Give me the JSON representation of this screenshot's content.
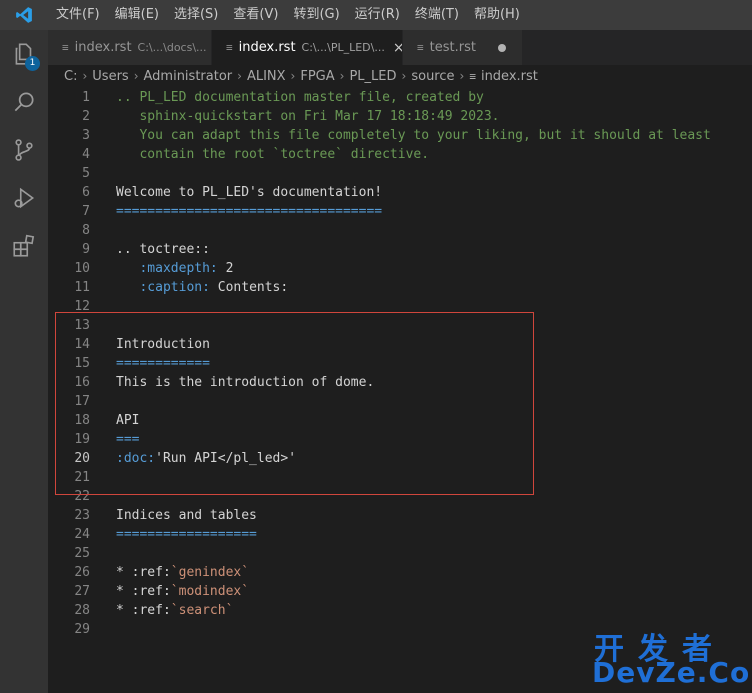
{
  "menu": [
    "文件(F)",
    "编辑(E)",
    "选择(S)",
    "查看(V)",
    "转到(G)",
    "运行(R)",
    "终端(T)",
    "帮助(H)"
  ],
  "activity": {
    "explorer_badge": "1",
    "icons": [
      "files-icon",
      "search-icon",
      "source-control-icon",
      "run-debug-icon",
      "extensions-icon"
    ]
  },
  "tabs": [
    {
      "label": "index.rst",
      "path": "C:\\...\\docs\\...",
      "active": false
    },
    {
      "label": "index.rst",
      "path": "C:\\...\\PL_LED\\...",
      "active": true,
      "close": "×"
    },
    {
      "label": "test.rst",
      "path": "",
      "active": false,
      "dirty": true
    }
  ],
  "breadcrumb": [
    "C:",
    "Users",
    "Administrator",
    "ALINX",
    "FPGA",
    "PL_LED",
    "source",
    "index.rst"
  ],
  "editor": {
    "current_line": 20,
    "lines": [
      {
        "n": "1",
        "tokens": [
          [
            "comment",
            ".. PL_LED documentation master file, created by"
          ]
        ]
      },
      {
        "n": "2",
        "tokens": [
          [
            "comment",
            "   sphinx-quickstart on Fri Mar 17 18:18:49 2023."
          ]
        ]
      },
      {
        "n": "3",
        "tokens": [
          [
            "comment",
            "   You can adapt this file completely to your liking, but it should at least"
          ]
        ]
      },
      {
        "n": "4",
        "tokens": [
          [
            "comment",
            "   contain the root `toctree` directive."
          ]
        ]
      },
      {
        "n": "5",
        "tokens": []
      },
      {
        "n": "6",
        "tokens": [
          [
            "heading",
            "Welcome to PL_LED's documentation!"
          ]
        ]
      },
      {
        "n": "7",
        "tokens": [
          [
            "rule",
            "=================================="
          ]
        ]
      },
      {
        "n": "8",
        "tokens": []
      },
      {
        "n": "9",
        "tokens": [
          [
            "white",
            ".. toctree::"
          ]
        ]
      },
      {
        "n": "10",
        "tokens": [
          [
            "white",
            "   "
          ],
          [
            "field",
            ":maxdepth:"
          ],
          [
            "white",
            " 2"
          ]
        ]
      },
      {
        "n": "11",
        "tokens": [
          [
            "white",
            "   "
          ],
          [
            "field",
            ":caption:"
          ],
          [
            "white",
            " Contents:"
          ]
        ]
      },
      {
        "n": "12",
        "tokens": []
      },
      {
        "n": "13",
        "tokens": []
      },
      {
        "n": "14",
        "tokens": [
          [
            "heading",
            "Introduction"
          ]
        ]
      },
      {
        "n": "15",
        "tokens": [
          [
            "rule",
            "============"
          ]
        ]
      },
      {
        "n": "16",
        "tokens": [
          [
            "white",
            "This is the introduction of dome."
          ]
        ]
      },
      {
        "n": "17",
        "tokens": []
      },
      {
        "n": "18",
        "tokens": [
          [
            "heading",
            "API"
          ]
        ]
      },
      {
        "n": "19",
        "tokens": [
          [
            "rule",
            "==="
          ]
        ]
      },
      {
        "n": "20",
        "tokens": [
          [
            "field",
            ":doc:"
          ],
          [
            "white",
            "'Run API</pl_led>'"
          ]
        ]
      },
      {
        "n": "21",
        "tokens": []
      },
      {
        "n": "22",
        "tokens": []
      },
      {
        "n": "23",
        "tokens": [
          [
            "heading",
            "Indices and tables"
          ]
        ]
      },
      {
        "n": "24",
        "tokens": [
          [
            "rule",
            "=================="
          ]
        ]
      },
      {
        "n": "25",
        "tokens": []
      },
      {
        "n": "26",
        "tokens": [
          [
            "white",
            "* :ref:"
          ],
          [
            "string",
            "`genindex`"
          ]
        ]
      },
      {
        "n": "27",
        "tokens": [
          [
            "white",
            "* :ref:"
          ],
          [
            "string",
            "`modindex`"
          ]
        ]
      },
      {
        "n": "28",
        "tokens": [
          [
            "white",
            "* :ref:"
          ],
          [
            "string",
            "`search`"
          ]
        ]
      },
      {
        "n": "29",
        "tokens": []
      }
    ]
  },
  "watermark": {
    "cn": "开发者",
    "en": "DevZe.CoM"
  },
  "colors": {
    "accent": "#0e639c",
    "highlight_box": "#d0463c",
    "comment": "#6a9955",
    "keyword": "#569cd6",
    "string": "#ce9178"
  }
}
